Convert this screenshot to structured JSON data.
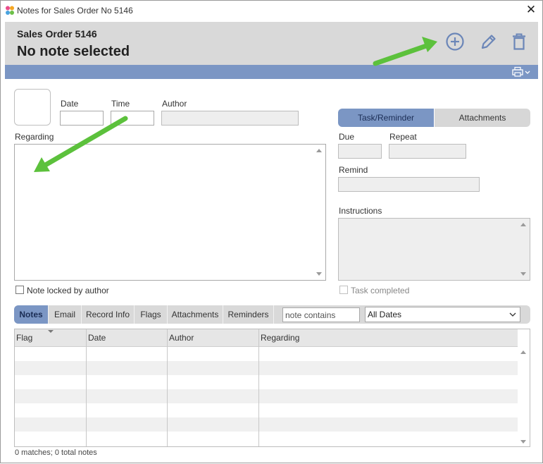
{
  "window": {
    "title": "Notes for Sales Order No 5146"
  },
  "header": {
    "subtitle": "Sales Order 5146",
    "title": "No note selected"
  },
  "form": {
    "date_label": "Date",
    "time_label": "Time",
    "author_label": "Author",
    "regarding_label": "Regarding",
    "locked_label": "Note locked by author"
  },
  "task": {
    "tab_task": "Task/Reminder",
    "tab_attachments": "Attachments",
    "due_label": "Due",
    "repeat_label": "Repeat",
    "remind_label": "Remind",
    "instructions_label": "Instructions",
    "completed_label": "Task completed"
  },
  "bottom_tabs": [
    "Notes",
    "Email",
    "Record Info",
    "Flags",
    "Attachments",
    "Reminders"
  ],
  "filter": {
    "placeholder": "note contains",
    "dates_value": "All Dates"
  },
  "grid": {
    "columns": [
      "Flag",
      "Date",
      "Author",
      "Regarding"
    ]
  },
  "status": "0 matches; 0 total notes",
  "colors": {
    "accent_blue": "#7b96c4",
    "arrow_green": "#5cc13c",
    "header_gray": "#d9d9d9"
  },
  "icons": [
    "app-icon",
    "close-icon",
    "add-note-icon",
    "edit-icon",
    "delete-icon",
    "print-icon"
  ]
}
